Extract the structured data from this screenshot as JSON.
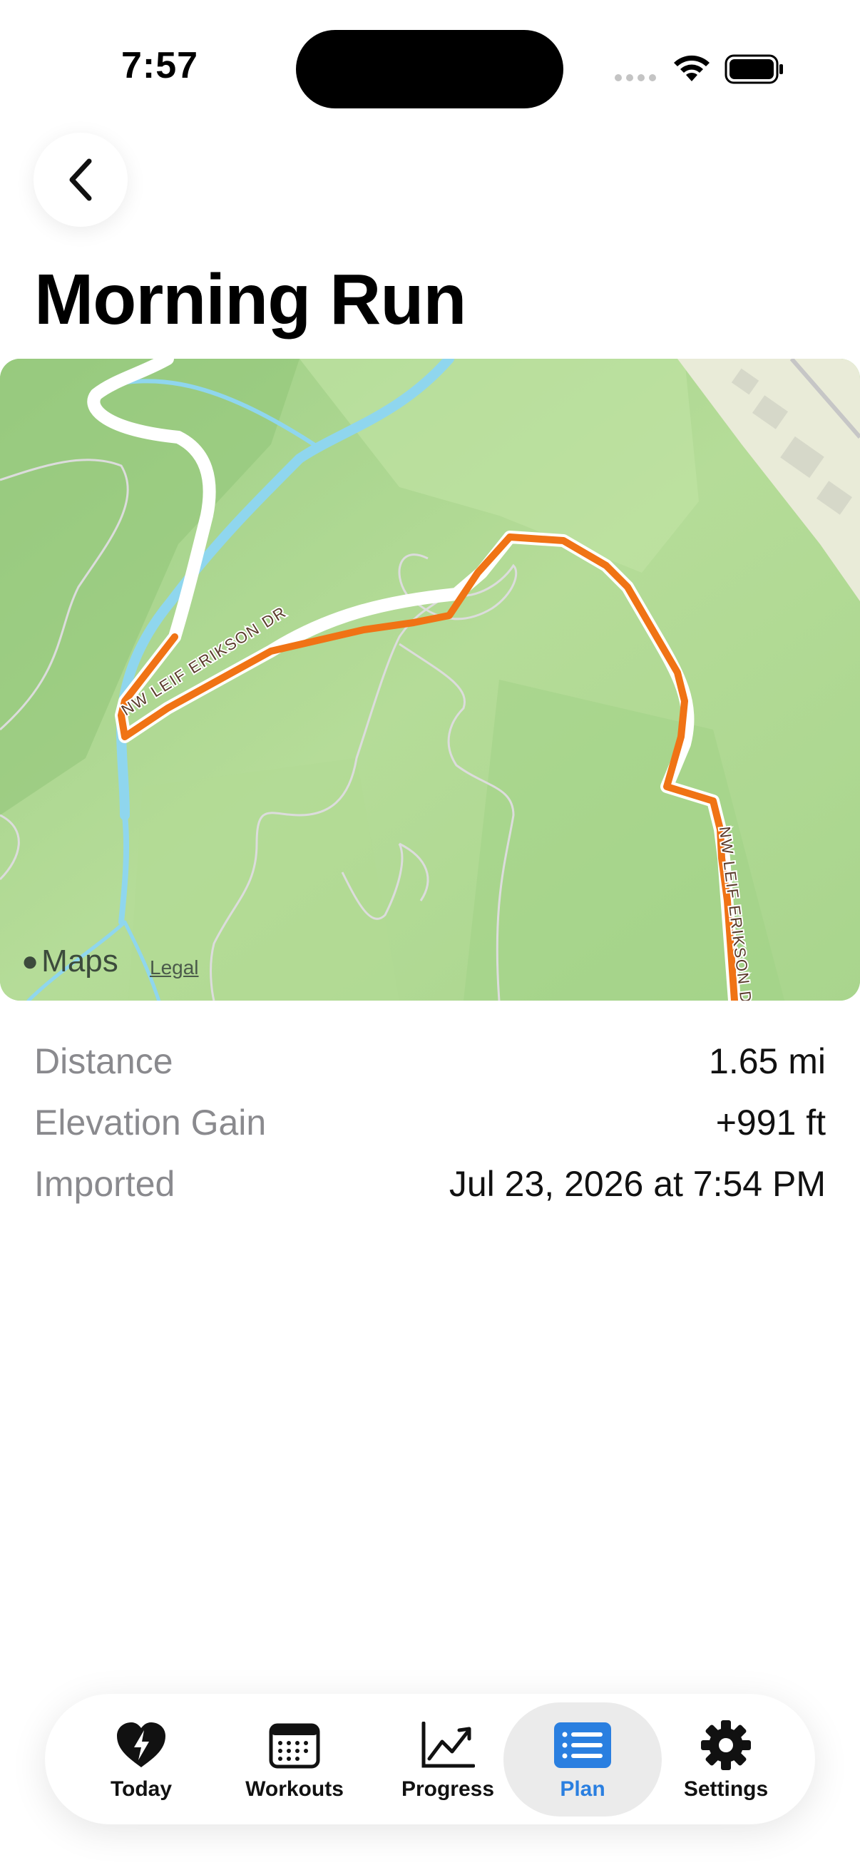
{
  "status_bar": {
    "time": "7:57"
  },
  "page": {
    "title": "Morning Run"
  },
  "map": {
    "road_labels": [
      "NW LEIF ERIKSON DR",
      "NW LEIF ERIKSON DR"
    ],
    "brand": "Maps",
    "legal": "Legal",
    "route_color": "#f07315",
    "water_color": "#8fd6ee"
  },
  "stats": [
    {
      "label": "Distance",
      "value": "1.65 mi"
    },
    {
      "label": "Elevation Gain",
      "value": "+991 ft"
    },
    {
      "label": "Imported",
      "value": "Jul 23, 2026 at 7:54 PM"
    }
  ],
  "tabs": [
    {
      "label": "Today",
      "icon": "heart-bolt-icon",
      "active": false
    },
    {
      "label": "Workouts",
      "icon": "calendar-icon",
      "active": false
    },
    {
      "label": "Progress",
      "icon": "chart-trend-icon",
      "active": false
    },
    {
      "label": "Plan",
      "icon": "list-icon",
      "active": true
    },
    {
      "label": "Settings",
      "icon": "gear-icon",
      "active": false
    }
  ],
  "accent_color": "#2a7fe0"
}
